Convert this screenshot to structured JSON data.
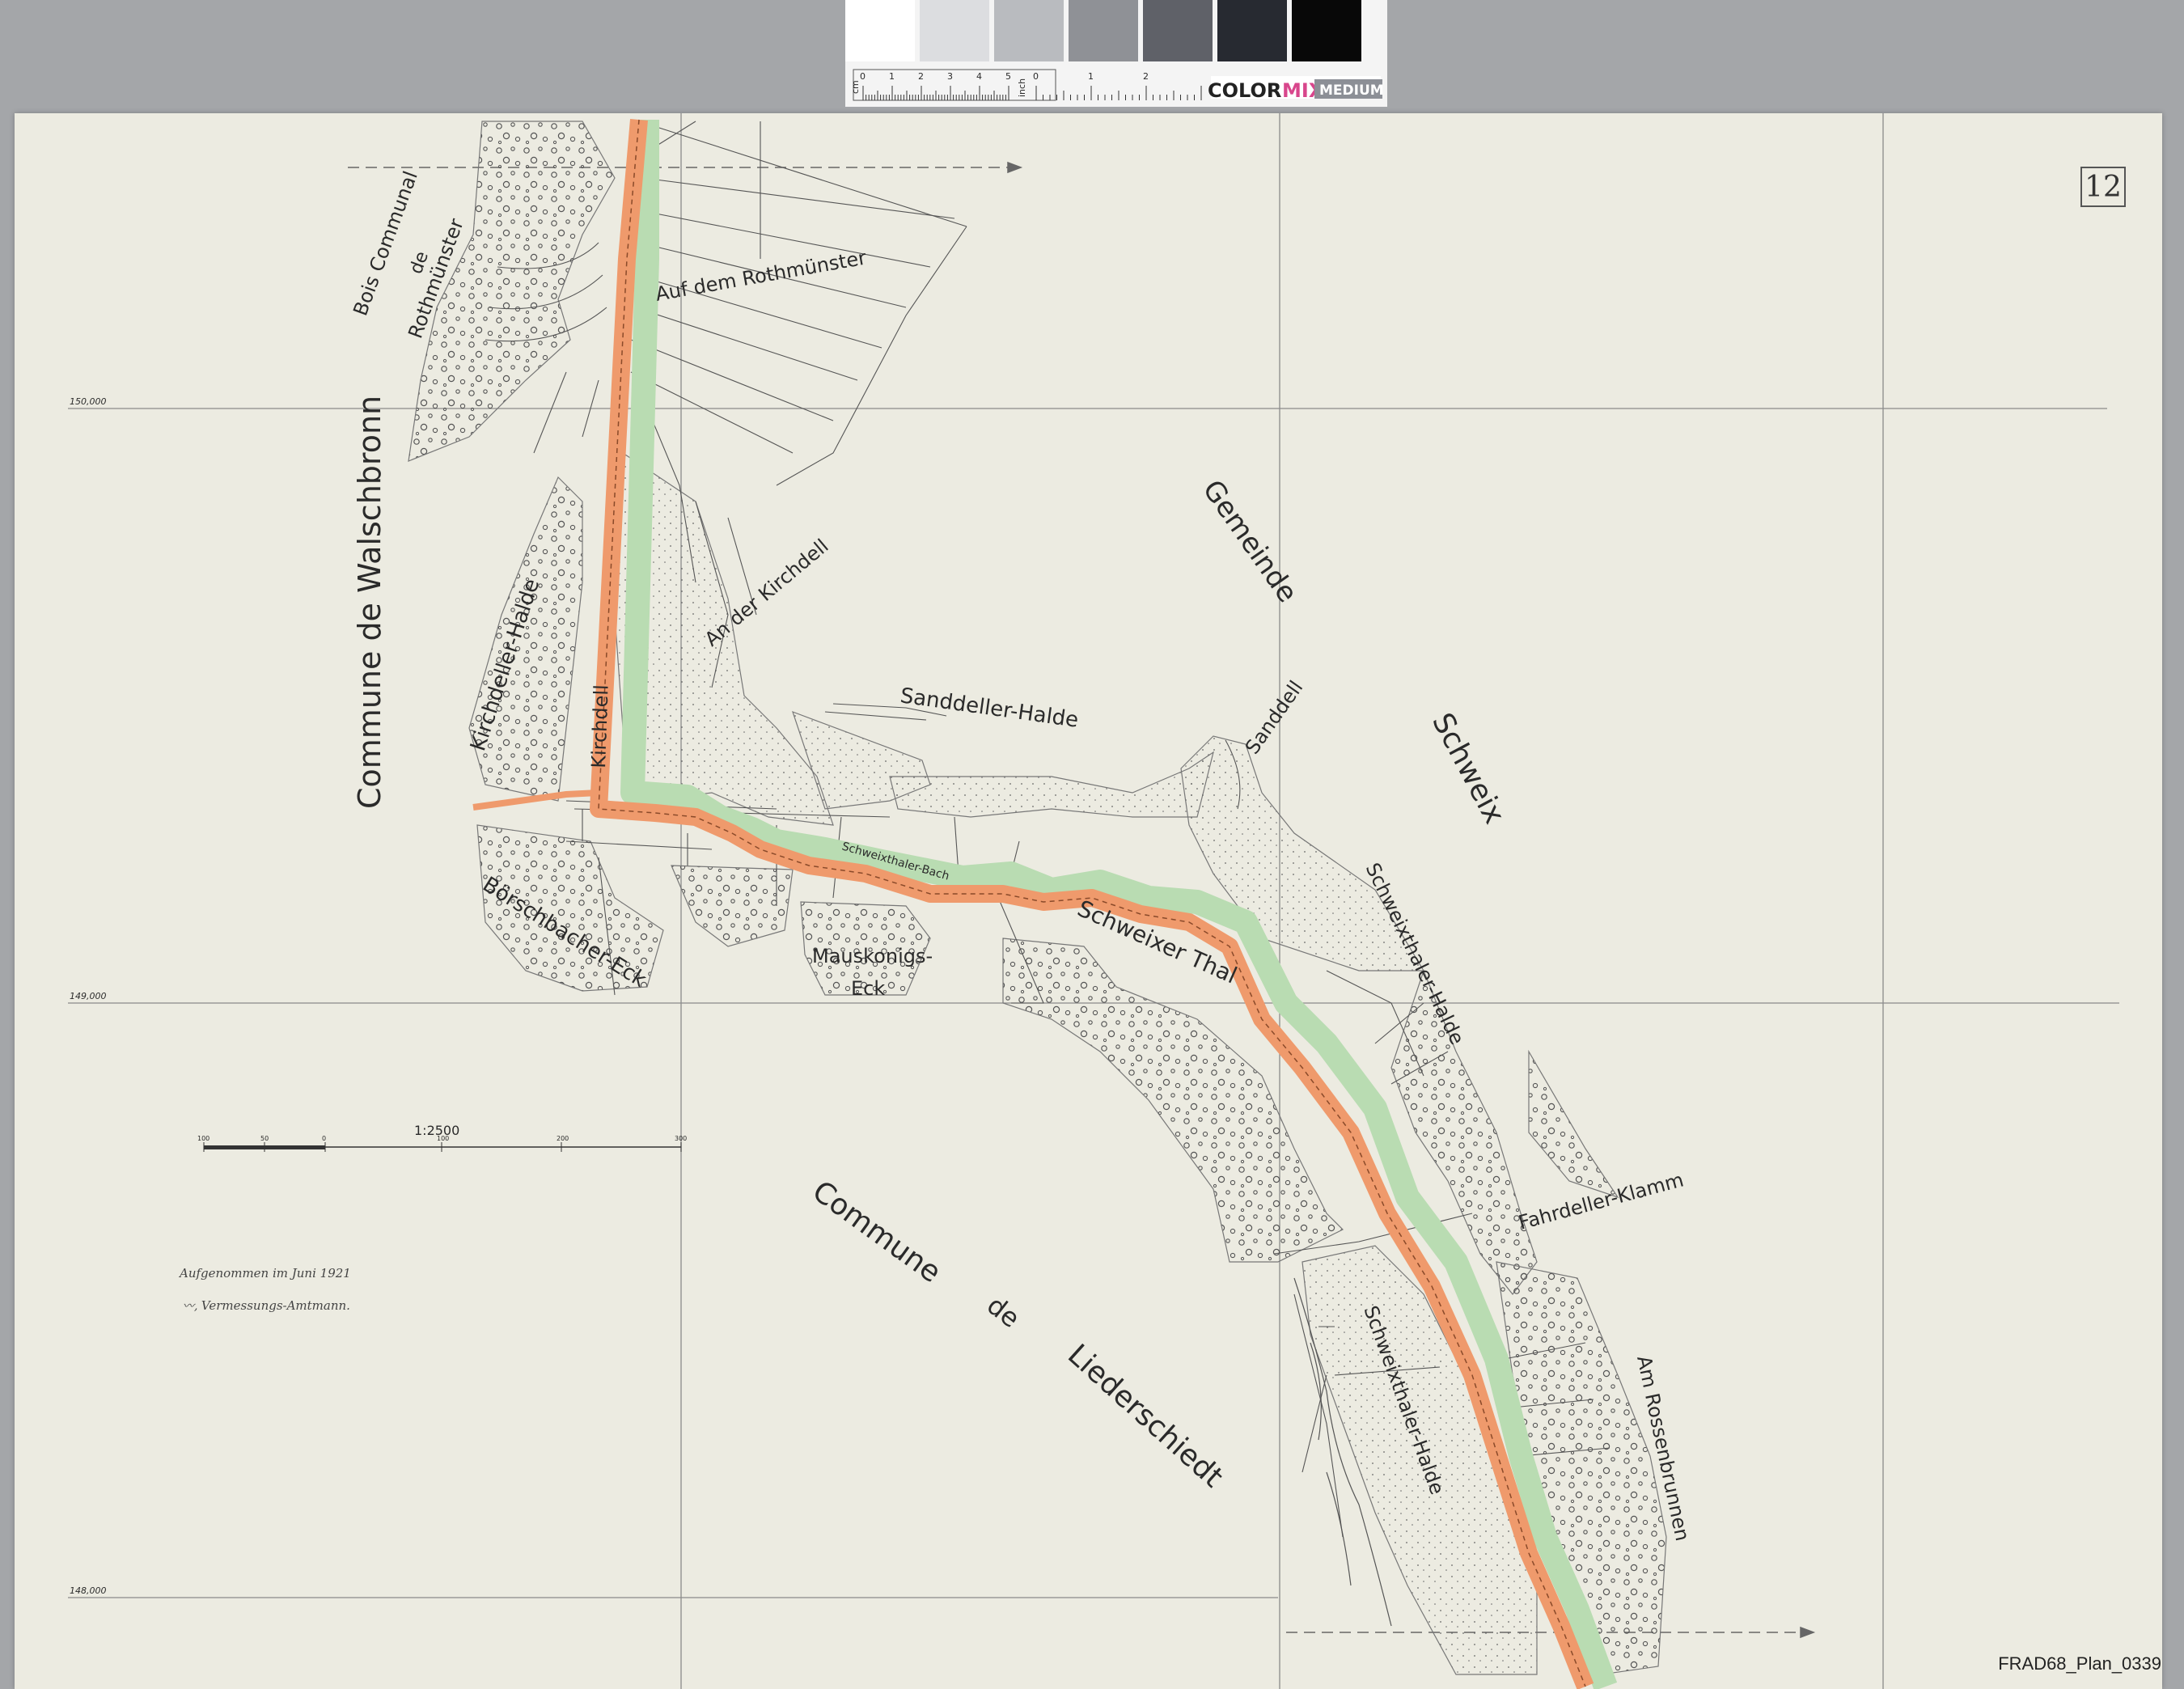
{
  "colorbar": {
    "swatches": [
      "#ffffff",
      "#dcdde0",
      "#b9bbbf",
      "#8f9196",
      "#5f6168",
      "#272a31",
      "#080808"
    ],
    "cm_label": "cm",
    "inch_label": "inch",
    "brand_prefix": "COLOR",
    "brand_mid": "MIX",
    "brand_badge": "MEDIUM",
    "cm_ticks": [
      "0",
      "1",
      "2",
      "3",
      "4",
      "5"
    ],
    "inch_ticks": [
      "0",
      "1",
      "2"
    ]
  },
  "plate_number": "12",
  "file_name": "FRAD68_Plan_0339",
  "coordinate_labels": [
    "150,000",
    "149,000",
    "148,000"
  ],
  "scale": {
    "ratio": "1:2500",
    "ticks": [
      "100",
      "50",
      "0",
      "100",
      "200",
      "300"
    ]
  },
  "credit": {
    "line1": "Aufgenommen im Juni 1921",
    "line2": "Vermessungs-Amtmann."
  },
  "place_names": {
    "bois_communal": "Bois Communal",
    "de_small": "de",
    "rothmunster": "Rothmünster",
    "walschbronn": "Commune    de    Walschbronn",
    "kirchdeller_halde": "Kirchdeller-Halde",
    "kirchdell": "Kirchdell",
    "auf_dem_rothmunster": "Auf dem Rothmünster",
    "an_der_kirchdell": "An der Kirchdell",
    "sanddeller_halde": "Sanddeller-Halde",
    "sanddell": "Sanddell",
    "gemeinde": "Gemeinde",
    "schweix": "Schweix",
    "borschbacher_eck": "Börschbacher-Eck",
    "mauskonigs": "Mauskonigs-",
    "eck": "Eck",
    "schweixer_thal": "Schweixer     Thal",
    "schweixthaler_bach": "Schweixthaler-Bach",
    "schweixthaler_halde_upper": "Schweixthaler-Halde",
    "fahrdeller_klamm": "Fahrdeller-Klamm",
    "commune": "Commune",
    "de": "de",
    "liederschiedt": "Liederschiedt",
    "schweixthaler_halde_lower": "Schweixthaler-Halde",
    "am_rossenbrunnen": "Am Rossenbrunnen"
  },
  "colors": {
    "boundary_orange": "#ef9a6c",
    "boundary_green": "#b9dcb2",
    "paper": "#ecebe1",
    "ink": "#3a3a3a"
  }
}
